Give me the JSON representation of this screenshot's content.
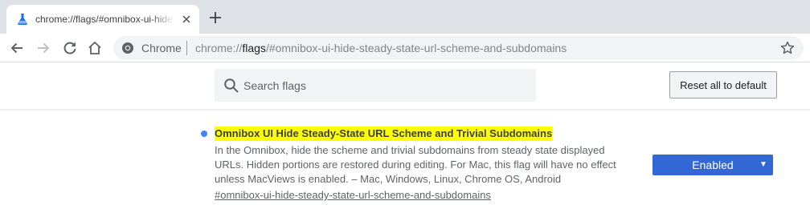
{
  "tab": {
    "title": "chrome://flags/#omnibox-ui-hide-steady-state-url-scheme-and-subdomains",
    "favicon": "flask-icon",
    "close_icon": "close-icon"
  },
  "toolbar": {
    "icons": [
      "back-arrow-icon",
      "forward-arrow-icon",
      "reload-icon",
      "home-icon"
    ],
    "chip_label": "Chrome",
    "url_scheme": "chrome://",
    "url_host": "flags",
    "url_rest": "/#omnibox-ui-hide-steady-state-url-scheme-and-subdomains",
    "star_icon": "star-icon"
  },
  "header": {
    "search_placeholder": "Search flags",
    "reset_label": "Reset all to default"
  },
  "flag": {
    "title": "Omnibox UI Hide Steady-State URL Scheme and Trivial Subdomains",
    "description": "In the Omnibox, hide the scheme and trivial subdomains from steady state displayed URLs. Hidden portions are restored during editing. For Mac, this flag will have no effect unless MacViews is enabled. – Mac, Windows, Linux, Chrome OS, Android",
    "link": "#omnibox-ui-hide-steady-state-url-scheme-and-subdomains",
    "state": "Enabled"
  },
  "colors": {
    "tabstrip": "#dee1e6",
    "highlight": "#ffff00",
    "select_blue": "#3367d6",
    "dot_blue": "#4285f4"
  }
}
